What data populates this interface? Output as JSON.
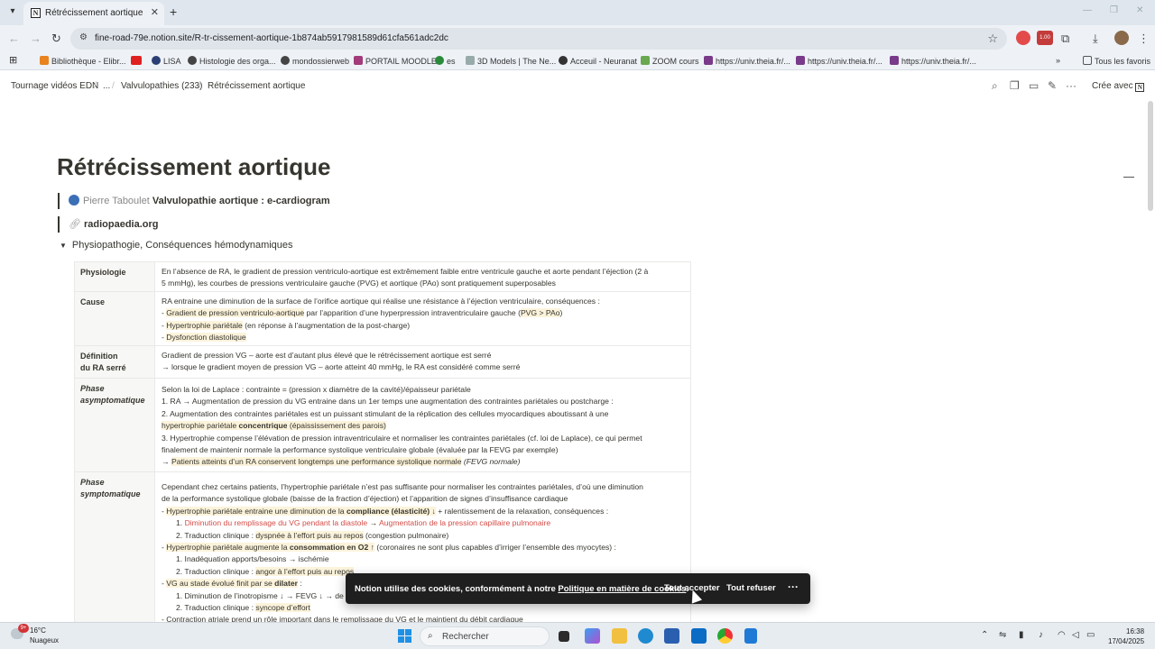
{
  "browser": {
    "tab_title": "Rétrécissement aortique",
    "tab_favicon": "N",
    "url": "fine-road-79e.notion.site/R-tr-cissement-aortique-1b874ab5917981589d61cfa561adc2dc",
    "bookmarks": [
      "Bibliothèque - Elibr...",
      "LISA",
      "Histologie des orga...",
      "mondossierweb",
      "PORTAIL MOODLE",
      "es",
      "3D Models | The Ne...",
      "Acceuil - Neuranat",
      "ZOOM cours",
      "https://univ.theia.fr/...",
      "https://univ.theia.fr/...",
      "https://univ.theia.fr/..."
    ],
    "all_bookmarks": "Tous les favoris",
    "ext_badge": "1.00"
  },
  "breadcrumb": {
    "items": [
      "Tournage vidéos EDN",
      "...",
      "Valvulopathies (233)",
      "Rétrécissement aortique"
    ]
  },
  "topbar": {
    "share": "Crée avec"
  },
  "page": {
    "title": "Rétrécissement aortique",
    "mention_author": "Pierre Taboulet",
    "mention_link": "Valvulopathie aortique : e-cardiogram",
    "weblink": "radiopaedia.org",
    "toggle": "Physiopathogie, Conséquences hémodynamiques"
  },
  "table": {
    "physio_head": "Physiologie",
    "physio_l1": "En l’absence de RA, le gradient de pression ventriculo-aortique est extrêmement faible entre ventricule gauche et aorte pendant l’éjection (2 à",
    "physio_l2": "5 mmHg), les courbes de pressions ventriculaire gauche (PVG) et aortique (PAo) sont pratiquement superposables",
    "cause_head": "Cause",
    "cause_l1": "RA entraine une diminution de la surface de l’orifice aortique qui réalise une résistance à l’éjection ventriculaire, conséquences :",
    "cause_l2a": "- ",
    "cause_l2b": "Gradient de pression ventriculo-aortique",
    "cause_l2c": " par l’apparition d’une hyperpression intraventriculaire gauche (",
    "cause_l2d": "PVG > PAo",
    "cause_l2e": ")",
    "cause_l3a": "- ",
    "cause_l3b": "Hypertrophie pariétale",
    "cause_l3c": " (en réponse à l’augmentation de la post-charge)",
    "cause_l4a": "- ",
    "cause_l4b": "Dysfonction diastolique",
    "def_head_1": "Définition",
    "def_head_2": "du RA serré",
    "def_l1": "Gradient de pression VG – aorte est d’autant plus élevé que le rétrécissement aortique est serré",
    "def_l2": "→ lorsque le gradient moyen de pression VG – aorte atteint 40 mmHg, le RA est considéré comme serré",
    "asym_head_1": "Phase",
    "asym_head_2": "asymptomatique",
    "asym_l1": "Selon la loi de Laplace : contrainte = (pression x diamètre de la cavité)/épaisseur pariétale",
    "asym_l2": "1. RA → Augmentation de pression du VG entraine dans un 1er temps une augmentation des contraintes pariétales ou postcharge :",
    "asym_l3": "2. Augmentation des contraintes pariétales est un puissant stimulant de la réplication des cellules myocardiques aboutissant à une",
    "asym_l4a": "hypertrophie pariétale ",
    "asym_l4b": "concentrique",
    "asym_l4c": " (épaississement des parois)",
    "asym_l5": "3. Hypertrophie compense l’élévation de pression intraventriculaire et normaliser les contraintes pariétales (cf. loi de Laplace), ce qui permet",
    "asym_l6": "finalement de maintenir normale la performance systolique ventriculaire globale (évaluée par la FEVG par exemple)",
    "asym_l7a": "→ ",
    "asym_l7b": "Patients atteints d’un RA conservent longtemps une performance systolique normale",
    "asym_l7c": " (FEVG normale)",
    "sym_head_1": "Phase",
    "sym_head_2": "symptomatique",
    "sym_l1": "Cependant chez certains patients, l’hypertrophie pariétale n’est pas suffisante pour normaliser les contraintes pariétales, d’où une diminution",
    "sym_l2": "de la performance systolique globale (baisse de la fraction d’éjection) et l’apparition de signes d’insuffisance cardiaque",
    "sym_l3a": "- ",
    "sym_l3b": "Hypertrophie pariétale entraine une diminution de la ",
    "sym_l3c": "compliance (élasticité)",
    "sym_l3d": " ↓",
    "sym_l3e": " + ralentissement de la relaxation, conséquences :",
    "sym_l4a": "1. ",
    "sym_l4b": "Diminution du remplissage du VG pendant la diastole",
    "sym_l4c": " → ",
    "sym_l4d": "Augmentation de la pression capillaire pulmonaire",
    "sym_l5a": "2. Traduction clinique : ",
    "sym_l5b": "dyspnée à l’effort puis au repos",
    "sym_l5c": " (congestion pulmonaire)",
    "sym_l6a": "- ",
    "sym_l6b": "Hypertrophie pariétale augmente la ",
    "sym_l6c": "consommation en O2",
    "sym_l6d": " ↑",
    "sym_l6e": " (coronaires ne sont plus capables d’irriger l’ensemble des myocytes) :",
    "sym_l7": "1. Inadéquation apports/besoins → ischémie",
    "sym_l8a": "2. Traduction clinique : ",
    "sym_l8b": "angor à l’effort puis au repos",
    "sym_l9a": "- ",
    "sym_l9b": "VG au stade évolué finit par se ",
    "sym_l9c": "dilater",
    "sym_l9d": " :",
    "sym_l10": "1. Diminution de l’inotropisme ↓ → FEVG ↓ → de",
    "sym_l11a": "2. Traduction clinique : ",
    "sym_l11b": "syncope d’effort",
    "sym_l12": "- Contraction atriale prend un rôle important dans le remplissage du VG et le maintient du débit cardiaque"
  },
  "cookie": {
    "message": "Notion utilise des cookies, conformément à notre ",
    "policy_link": "Politique en matière de cookies",
    "period": ".",
    "accept": "Tout accepter",
    "refuse": "Tout refuser",
    "more": "···"
  },
  "taskbar": {
    "temp": "16°C",
    "weather": "Nuageux",
    "badge": "9+",
    "search": "Rechercher",
    "time": "16:38",
    "date": "17/04/2025"
  },
  "colors": {
    "accent_red": "#d44c47",
    "highlight": "#fbf3db",
    "windows_blue": "#1e90e6"
  }
}
